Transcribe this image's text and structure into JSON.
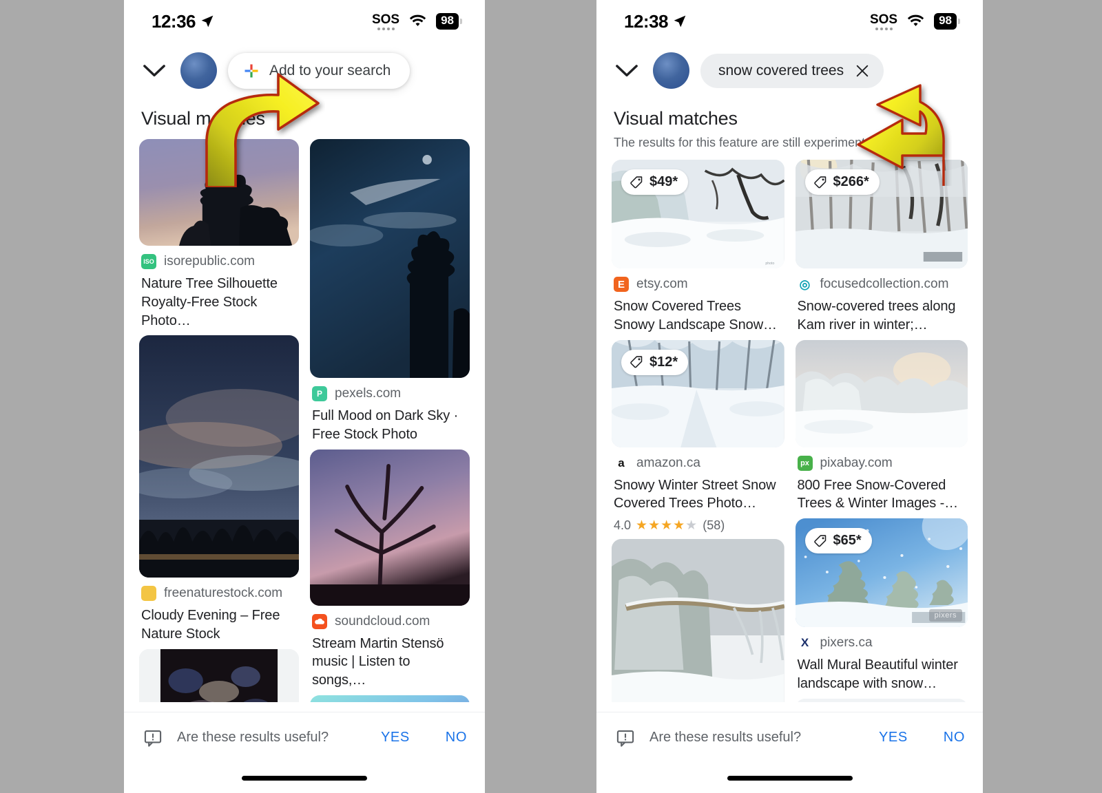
{
  "phones": [
    {
      "id": "left",
      "status": {
        "time": "12:36",
        "sos": "SOS",
        "battery": "98"
      },
      "header": {
        "collapse_icon": "chevron-down-icon",
        "avatar": "profile-avatar",
        "add_chip_label": "Add to your search",
        "add_chip_icon": "plus-icon"
      },
      "section": {
        "title": "Visual matches",
        "subtitle": ""
      },
      "results": [
        {
          "column": 0,
          "source": "isorepublic.com",
          "favicon": "isorepublic-favicon",
          "favicon_color": "#34c27f",
          "favicon_text": "ISO",
          "title": "Nature Tree Silhouette Royalty-Free Stock Photo…",
          "price": "",
          "rating": "",
          "thumb_height": 155,
          "image": "tree-silhouette-dusk-sky"
        },
        {
          "column": 1,
          "source": "pexels.com",
          "favicon": "pexels-favicon",
          "favicon_color": "#3ec99a",
          "favicon_text": "P",
          "title": "Full Mood on Dark Sky · Free Stock Photo",
          "price": "",
          "rating": "",
          "thumb_height": 347,
          "image": "dark-blue-night-sky-pines"
        },
        {
          "column": 0,
          "source": "freenaturestock.com",
          "favicon": "freenaturestock-favicon",
          "favicon_color": "#f3c544",
          "favicon_text": "",
          "title": "Cloudy Evening – Free Nature Stock",
          "price": "",
          "rating": "",
          "thumb_height": 352,
          "image": "cloudy-evening-treeline"
        },
        {
          "column": 1,
          "source": "soundcloud.com",
          "favicon": "soundcloud-favicon",
          "favicon_color": "#f4511e",
          "favicon_text": "",
          "title": "Stream Martin Stensö music | Listen to songs,…",
          "price": "",
          "rating": "",
          "thumb_height": 227,
          "image": "purple-dusk-bare-tree"
        },
        {
          "column": 0,
          "source": "",
          "favicon": "",
          "favicon_color": "",
          "favicon_text": "",
          "title": "",
          "price": "",
          "rating": "",
          "thumb_height": 100,
          "image": "dark-blue-abstract-foliage"
        },
        {
          "column": 1,
          "source": "",
          "favicon": "",
          "favicon_color": "",
          "favicon_text": "",
          "title": "",
          "price": "",
          "rating": "",
          "thumb_height": 60,
          "image": "teal-blue-gradient-sky"
        }
      ],
      "feedback": {
        "icon": "feedback-icon",
        "question": "Are these results useful?",
        "yes": "YES",
        "no": "NO"
      }
    },
    {
      "id": "right",
      "status": {
        "time": "12:38",
        "sos": "SOS",
        "battery": "98"
      },
      "header": {
        "collapse_icon": "chevron-down-icon",
        "avatar": "profile-avatar",
        "query_value": "snow covered trees",
        "clear_icon": "close-icon"
      },
      "section": {
        "title": "Visual matches",
        "subtitle": "The results for this feature are still experimental"
      },
      "results": [
        {
          "column": 0,
          "source": "etsy.com",
          "favicon": "etsy-favicon",
          "favicon_color": "#f1641e",
          "favicon_text": "E",
          "title": "Snow Covered Trees Snowy Landscape Snow…",
          "price": "$49*",
          "rating": "",
          "thumb_height": 158,
          "image": "snowy-forest-deep-snow"
        },
        {
          "column": 1,
          "source": "focusedcollection.com",
          "favicon": "focusedcollection-favicon",
          "favicon_color": "#ffffff",
          "favicon_text": "◎",
          "title": "Snow-covered trees along Kam river in winter;…",
          "price": "$266*",
          "rating": "",
          "thumb_height": 158,
          "image": "snowy-birch-forest-path"
        },
        {
          "column": 0,
          "source": "amazon.ca",
          "favicon": "amazon-favicon",
          "favicon_color": "#ffffff",
          "favicon_text": "a",
          "title": "Snowy Winter Street Snow Covered Trees Photo…",
          "price": "$12*",
          "rating": "4.0",
          "rating_count": "(58)",
          "stars": 4,
          "thumb_height": 156,
          "image": "snow-covered-tree-avenue"
        },
        {
          "column": 1,
          "source": "pixabay.com",
          "favicon": "pixabay-favicon",
          "favicon_color": "#48b14a",
          "favicon_text": "px",
          "title": "800 Free Snow-Covered Trees & Winter Images -…",
          "price": "",
          "rating": "",
          "thumb_height": 156,
          "image": "frosty-winter-field-sunrise"
        },
        {
          "column": 0,
          "source": "",
          "favicon": "",
          "favicon_color": "",
          "favicon_text": "",
          "title": "",
          "price": "",
          "rating": "",
          "thumb_height": 250,
          "image": "snow-laden-branches-closeup"
        },
        {
          "column": 1,
          "source": "pixers.ca",
          "favicon": "pixers-favicon",
          "favicon_color": "#ffffff",
          "favicon_text": "X",
          "title": "Wall Mural Beautiful winter landscape with snow…",
          "price": "$65*",
          "rating": "",
          "thumb_height": 158,
          "watermark": "pixers",
          "image": "snowy-firs-blue-sky-snowfall"
        },
        {
          "column": 1,
          "source": "",
          "favicon": "",
          "favicon_color": "",
          "favicon_text": "",
          "title": "",
          "price": "",
          "rating": "",
          "thumb_height": 50,
          "image": "snowy-branches-strip"
        }
      ],
      "feedback": {
        "icon": "feedback-icon",
        "question": "Are these results useful?",
        "yes": "YES",
        "no": "NO"
      }
    }
  ],
  "annotations": [
    {
      "name": "arrow-pointing-add-to-search",
      "fill": "#f0e11a",
      "stroke": "#b52a10"
    },
    {
      "name": "arrow-pointing-query-chip",
      "fill": "#f0e11a",
      "stroke": "#b52a10"
    }
  ],
  "colors": {
    "accent_blue": "#1a73e8",
    "text_primary": "#202124",
    "text_secondary": "#5f6368",
    "background": "#aaaaaa"
  }
}
